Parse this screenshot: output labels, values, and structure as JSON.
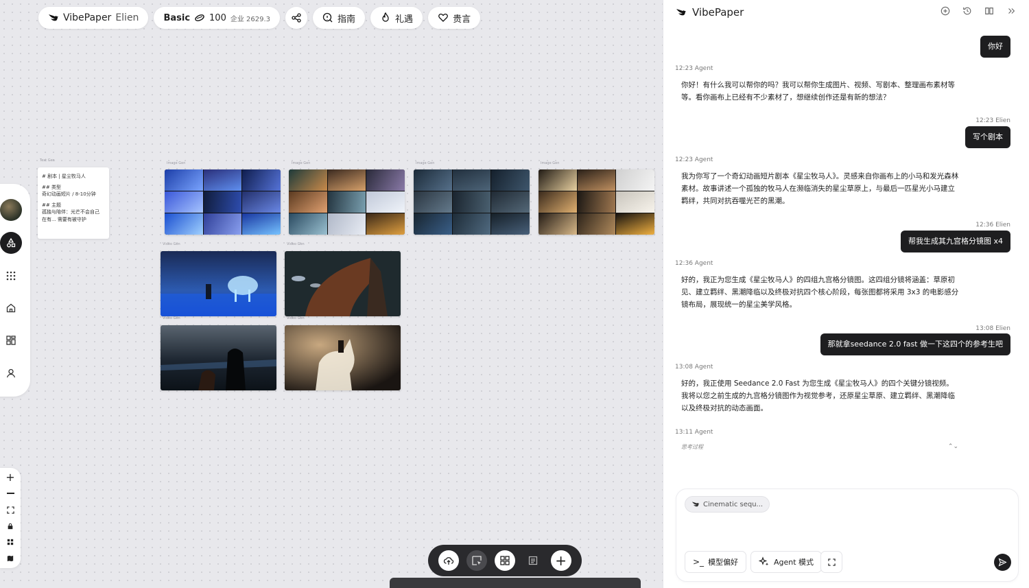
{
  "topbar": {
    "brand": "VibePaper",
    "user": "Elien",
    "plan": "Basic",
    "credits": "100",
    "enterprise": "企业 2629.3",
    "guide": "指南",
    "gift": "礼遇",
    "feedback": "贵言"
  },
  "canvas": {
    "text_node": {
      "label": "Text Gen",
      "title": "# 剧本 | 星尘牧马人",
      "type_heading": "## 类型",
      "type_value": "奇幻动画短片 / 8-10分钟",
      "theme_heading": "## 主题",
      "theme_value": "孤独与陪伴：光芒不会自己",
      "theme_more": "在有... 需要有被守护"
    },
    "image_label": "Image Gen",
    "video_label": "Video Gen"
  },
  "panel": {
    "title": "VibePaper",
    "messages": [
      {
        "role": "user",
        "text": "你好"
      },
      {
        "role": "agent",
        "meta": "12:23 Agent",
        "text": "你好！有什么我可以帮你的吗？我可以帮你生成图片、视频、写剧本、整理画布素材等等。看你画布上已经有不少素材了，想继续创作还是有新的想法？"
      },
      {
        "role": "user",
        "meta": "12:23 Elien",
        "text": "写个剧本"
      },
      {
        "role": "agent",
        "meta": "12:23 Agent",
        "text": "我为你写了一个奇幻动画短片剧本《星尘牧马人》。灵感来自你画布上的小马和发光森林素材。故事讲述一个孤独的牧马人在濒临消失的星尘草原上，与最后一匹星光小马建立羁绊，共同对抗吞噬光芒的黑潮。"
      },
      {
        "role": "user",
        "meta": "12:36 Elien",
        "text": "帮我生成其九宫格分镜图 x4"
      },
      {
        "role": "agent",
        "meta": "12:36 Agent",
        "text": "好的，我正为您生成《星尘牧马人》的四组九宫格分镜图。这四组分镜将涵盖：草原初见、建立羁绊、黑潮降临以及终极对抗四个核心阶段，每张图都将采用 3x3 的电影感分镜布局，展现统一的星尘美学风格。"
      },
      {
        "role": "user",
        "meta": "13:08 Elien",
        "text": "那就拿seedance 2.0 fast 做一下这四个的参考生吧"
      },
      {
        "role": "agent",
        "meta": "13:08 Agent",
        "text": "好的，我正使用 Seedance 2.0 Fast 为您生成《星尘牧马人》的四个关键分镜视频。我将以您之前生成的九宫格分镜图作为视觉参考，还原星尘草原、建立羁绊、黑潮降临以及终极对抗的动态画面。"
      },
      {
        "role": "agent",
        "meta": "13:11 Agent",
        "text": "思考过程"
      }
    ],
    "composer": {
      "chip": "Cinematic sequ...",
      "model_pref": "模型偏好",
      "agent_mode": "Agent 模式"
    }
  },
  "colors": {
    "dark": "#1e1e20",
    "canvas_bg": "#e8e8ec"
  }
}
